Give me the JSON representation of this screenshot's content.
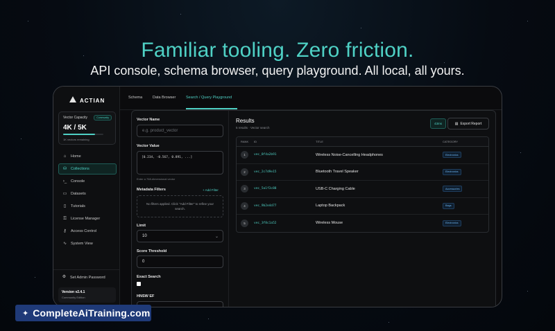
{
  "hero": {
    "title": "Familiar tooling. Zero friction.",
    "subtitle": "API console, schema browser, query playground. All local, all yours."
  },
  "sidebar": {
    "logo_text": "ACTIAN",
    "capacity": {
      "label": "Vector Capacity",
      "badge": "Community",
      "value": "4K / 5K",
      "remaining": "1K vectors remaining",
      "fill_percent": 80
    },
    "nav": [
      {
        "label": "Home",
        "icon": "⌂"
      },
      {
        "label": "Collections",
        "icon": "⛁",
        "active": true
      },
      {
        "label": "Console",
        "icon": "›_"
      },
      {
        "label": "Datasets",
        "icon": "▭"
      },
      {
        "label": "Tutorials",
        "icon": "▯"
      },
      {
        "label": "License Manager",
        "icon": "⚿"
      },
      {
        "label": "Access Control",
        "icon": "⚷"
      },
      {
        "label": "System View",
        "icon": "∿"
      }
    ],
    "admin_label": "Set Admin Password",
    "version": "Version v2.4.1",
    "edition": "Community Edition"
  },
  "tabs": [
    {
      "label": "Schema"
    },
    {
      "label": "Data Browser"
    },
    {
      "label": "Search / Query Playground",
      "active": true
    }
  ],
  "form": {
    "vector_name_label": "Vector Name",
    "vector_name_placeholder": "e.g. product_vector",
    "vector_value_label": "Vector Value",
    "vector_value": "[0.234, -0.567, 0.891, ...]",
    "vector_hint": "Enter a 768-dimensional vector",
    "metadata_label": "Metadata Filters",
    "add_filter": "+ Add Filter",
    "filters_empty": "No filters applied. Click \"Add Filter\" to refine your search.",
    "limit_label": "Limit",
    "limit_value": "10",
    "score_label": "Score Threshold",
    "score_value": "0",
    "exact_label": "Exact Search",
    "hnsw_label": "HNSW EF"
  },
  "results": {
    "title": "Results",
    "meta": "5 results · Vector search",
    "timing": "43ms",
    "export_label": "Export Report",
    "columns": [
      "RANK",
      "ID",
      "TITLE",
      "CATEGORY"
    ],
    "rows": [
      {
        "rank": "1",
        "id": "vec_8f4a2b91",
        "title": "Wireless Noise-Cancelling Headphones",
        "category": "Electronics"
      },
      {
        "rank": "2",
        "id": "vec_2c7d9e15",
        "title": "Bluetooth Travel Speaker",
        "category": "Electronics"
      },
      {
        "rank": "3",
        "id": "vec_5a1f3c88",
        "title": "USB-C Charging Cable",
        "category": "Accessories"
      },
      {
        "rank": "4",
        "id": "vec_9b2e4d77",
        "title": "Laptop Backpack",
        "category": "Bags"
      },
      {
        "rank": "5",
        "id": "vec_3f8c1a52",
        "title": "Wireless Mouse",
        "category": "Electronics"
      }
    ]
  },
  "watermark": {
    "text": "CompleteAiTraining.com"
  }
}
